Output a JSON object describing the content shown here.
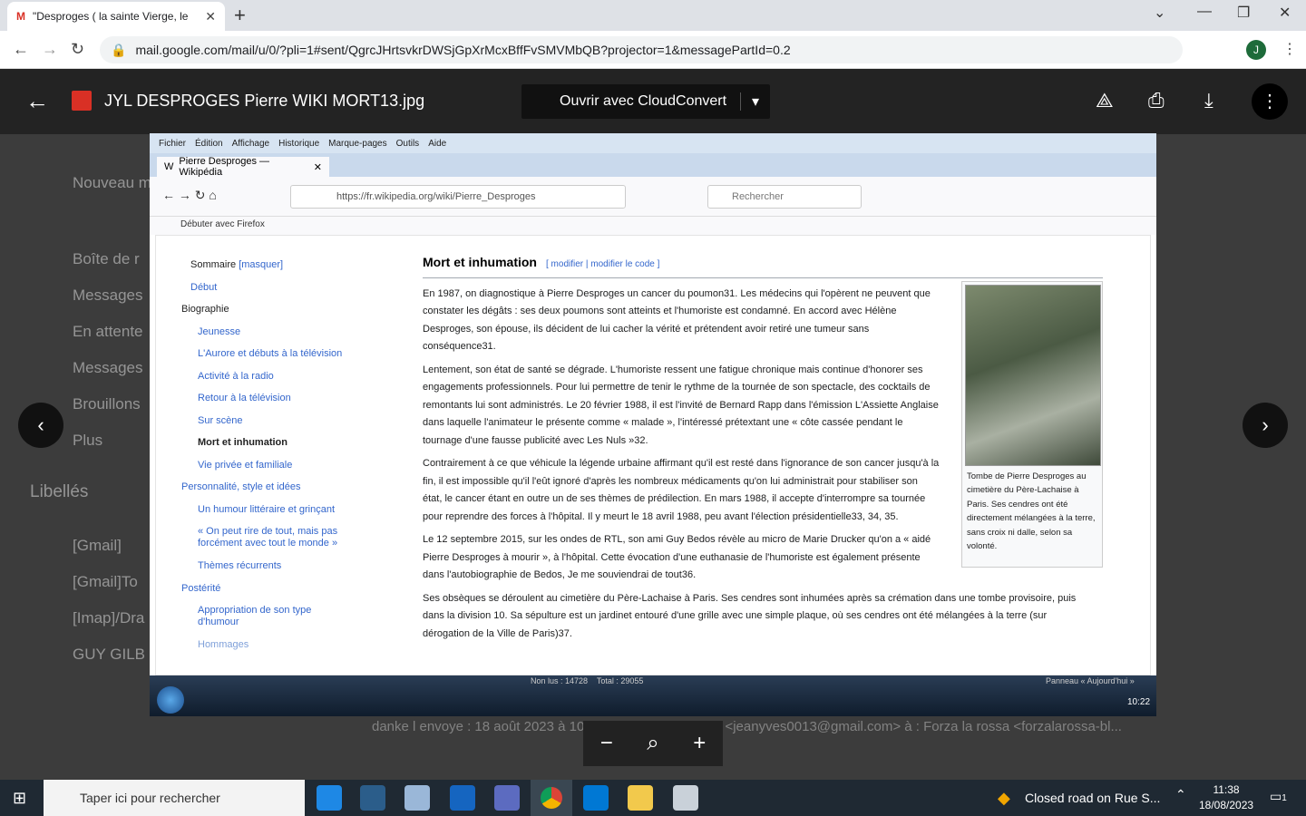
{
  "browser": {
    "tab_title": "\"Desproges ( la sainte Vierge, le",
    "url": "mail.google.com/mail/u/0/?pli=1#sent/QgrcJHrtsvkrDWSjGpXrMcxBffFvSMVMbQB?projector=1&messagePartId=0.2",
    "avatar": "J"
  },
  "viewer": {
    "file_name": "JYL DESPROGES Pierre WIKI MORT13.jpg",
    "open_with": "Ouvrir avec CloudConvert"
  },
  "gmail_bg": {
    "compose": "Nouveau m",
    "items": [
      "Boîte de r",
      "Messages",
      "En attente",
      "Messages",
      "Brouillons",
      "Plus"
    ],
    "labels_title": "Libellés",
    "labels": [
      "[Gmail]",
      "[Gmail]To",
      "[Imap]/Dra",
      "GUY GILB"
    ],
    "snippet": "danke l envoye : 18 août 2023 à 10:32 de : jeanyves 0013 <jeanyves0013@gmail.com> à : Forza la rossa <forzalarossa-bl..."
  },
  "firefox": {
    "menu": [
      "Fichier",
      "Édition",
      "Affichage",
      "Historique",
      "Marque-pages",
      "Outils",
      "Aide"
    ],
    "tab": "Pierre Desproges — Wikipédia",
    "url": "https://fr.wikipedia.org/wiki/Pierre_Desproges",
    "search": "Rechercher",
    "bookmark": "Débuter avec Firefox"
  },
  "toc": {
    "title": "Sommaire",
    "hide": "[masquer]",
    "items": [
      "Début",
      "Biographie",
      "Jeunesse",
      "L'Aurore et débuts à la télévision",
      "Activité à la radio",
      "Retour à la télévision",
      "Sur scène",
      "Mort et inhumation",
      "Vie privée et familiale",
      "Personnalité, style et idées",
      "Un humour littéraire et grinçant",
      "« On peut rire de tout, mais pas",
      "forcément avec tout le monde »",
      "Thèmes récurrents",
      "Postérité",
      "Appropriation de son type",
      "d'humour",
      "Hommages"
    ]
  },
  "article": {
    "heading": "Mort et inhumation",
    "edit": "[ modifier | modifier le code ]",
    "p1": "En 1987, on diagnostique à Pierre Desproges un cancer du poumon31. Les médecins qui l'opèrent ne peuvent que constater les dégâts : ses deux poumons sont atteints et l'humoriste est condamné. En accord avec Hélène Desproges, son épouse, ils décident de lui cacher la vérité et prétendent avoir retiré une tumeur sans conséquence31.",
    "p2": "Lentement, son état de santé se dégrade. L'humoriste ressent une fatigue chronique mais continue d'honorer ses engagements professionnels. Pour lui permettre de tenir le rythme de la tournée de son spectacle, des cocktails de remontants lui sont administrés. Le 20 février 1988, il est l'invité de Bernard Rapp dans l'émission L'Assiette Anglaise dans laquelle l'animateur le présente comme « malade », l'intéressé prétextant une « côte cassée pendant le tournage d'une fausse publicité avec Les Nuls »32.",
    "p3": "Contrairement à ce que véhicule la légende urbaine affirmant qu'il est resté dans l'ignorance de son cancer jusqu'à la fin, il est impossible qu'il l'eût ignoré d'après les nombreux médicaments qu'on lui administrait pour stabiliser son état, le cancer étant en outre un de ses thèmes de prédilection. En mars 1988, il accepte d'interrompre sa tournée pour reprendre des forces à l'hôpital. Il y meurt le 18 avril 1988, peu avant l'élection présidentielle33, 34, 35.",
    "p4": "Le 12 septembre 2015, sur les ondes de RTL, son ami Guy Bedos révèle au micro de Marie Drucker qu'on a « aidé Pierre Desproges à mourir », à l'hôpital. Cette évocation d'une euthanasie de l'humoriste est également présente dans l'autobiographie de Bedos, Je me souviendrai de tout36.",
    "p5": "Ses obsèques se déroulent au cimetière du Père-Lachaise à Paris. Ses cendres sont inhumées après sa crémation dans une tombe provisoire, puis dans la division 10. Sa sépulture est un jardinet entouré d'une grille avec une simple plaque, où ses cendres ont été mélangées à la terre (sur dérogation de la Ville de Paris)37.",
    "caption": "Tombe de Pierre Desproges au cimetière du Père-Lachaise à Paris. Ses cendres ont été directement mélangées à la terre, sans croix ni dalle, selon sa volonté."
  },
  "inner_taskbar": {
    "status": "Non lus : 14728    Total : 29055",
    "panel": "Panneau « Aujourd'hui »",
    "time": "10:22"
  },
  "windows": {
    "search": "Taper ici pour rechercher",
    "weather": "Closed road on Rue S...",
    "time": "11:38",
    "date": "18/08/2023",
    "notif": "1"
  }
}
